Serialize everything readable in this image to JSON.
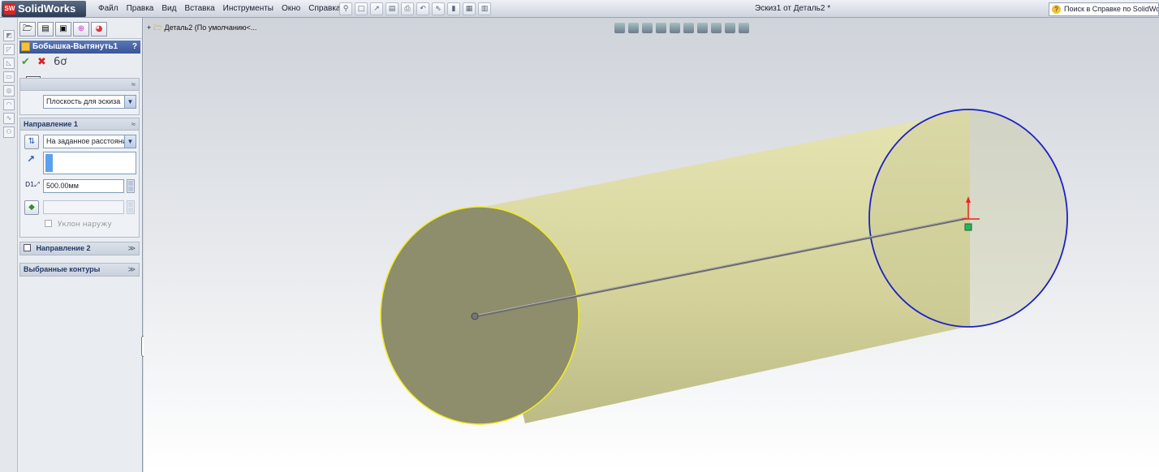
{
  "app": {
    "logo_text": "SolidWorks",
    "logo_mark": "SW"
  },
  "menu": [
    "Файл",
    "Правка",
    "Вид",
    "Вставка",
    "Инструменты",
    "Окно",
    "Справка"
  ],
  "document_title": "Эскиз1 от Деталь2 *",
  "help_search": {
    "placeholder": "Поиск в Справке по SolidWo"
  },
  "feature_tree": {
    "root": "Деталь2  (По умолчанию<..."
  },
  "property_manager": {
    "title": "Бобышка-Вытянуть1",
    "help_symbol": "?",
    "tooltip": "OK",
    "from_section": {
      "start_condition": "Плоскость для эскиза"
    },
    "direction1": {
      "label": "Направление 1",
      "end_condition": "На заданное расстояни",
      "depth": "500.00мм",
      "draft_outward": "Уклон наружу"
    },
    "direction2": {
      "label": "Направление 2",
      "checked": false
    },
    "selected_contours": {
      "label": "Выбранные контуры"
    }
  },
  "colors": {
    "cylinder_face": "#d9d8a0",
    "end_face": "#8e8d6c",
    "sketch_circle": "#1d20c4",
    "selected_edge": "#f2ee1e"
  }
}
